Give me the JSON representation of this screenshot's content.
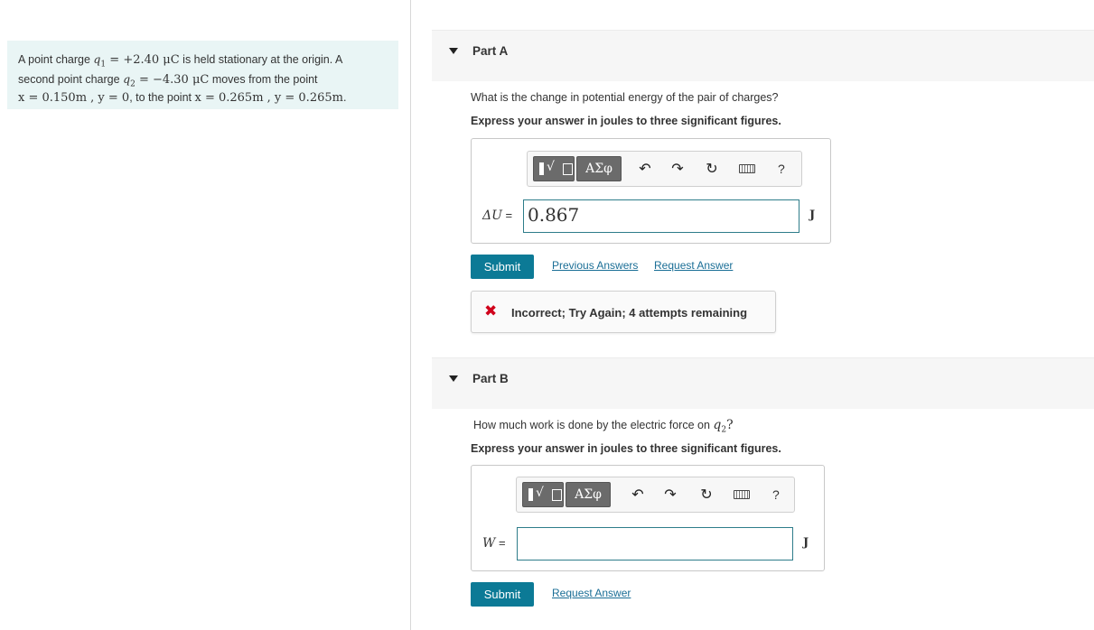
{
  "problem": {
    "text1": "A point charge ",
    "q1_sym": "q",
    "q1_sub": "1",
    "q1_val": " = +2.40 μC",
    "text2": " is held stationary at the origin. A",
    "text3": "second point charge ",
    "q2_sym": "q",
    "q2_sub": "2",
    "q2_val": " = −4.30 μC",
    "text4": " moves from the point",
    "pos1": "x = 0.150m , y = 0",
    "text5": ", to the point ",
    "pos2": "x = 0.265m , y = 0.265m",
    "text6": "."
  },
  "part_a": {
    "title": "Part A",
    "question": "What is the change in potential energy of the pair of charges?",
    "instruction": "Express your answer in joules to three significant figures.",
    "greek_label": "ΑΣφ",
    "help_label": "?",
    "label_sym": "ΔU",
    "label_eq": " =",
    "input_value": "0.867",
    "unit": "J",
    "submit_label": "Submit",
    "previous_answers_label": "Previous Answers",
    "request_answer_label": "Request Answer",
    "feedback_icon": "✖",
    "feedback_text": "Incorrect; Try Again; 4 attempts remaining"
  },
  "part_b": {
    "title": "Part B",
    "question_pre": "How much work is done by the electric force on ",
    "q_sym": "q",
    "q_sub": "2",
    "question_post": "?",
    "instruction": "Express your answer in joules to three significant figures.",
    "greek_label": "ΑΣφ",
    "help_label": "?",
    "label_sym": "W",
    "label_eq": " =",
    "input_value": "",
    "unit": "J",
    "submit_label": "Submit",
    "request_answer_label": "Request Answer"
  },
  "icons": {
    "template": "template-icon",
    "undo": "undo-icon",
    "redo": "redo-icon",
    "reset": "reset-icon",
    "keyboard": "keyboard-icon"
  },
  "colors": {
    "problem_bg": "#e9f5f5",
    "submit": "#0c7a96",
    "link": "#1a6e96",
    "error": "#d0021b"
  }
}
